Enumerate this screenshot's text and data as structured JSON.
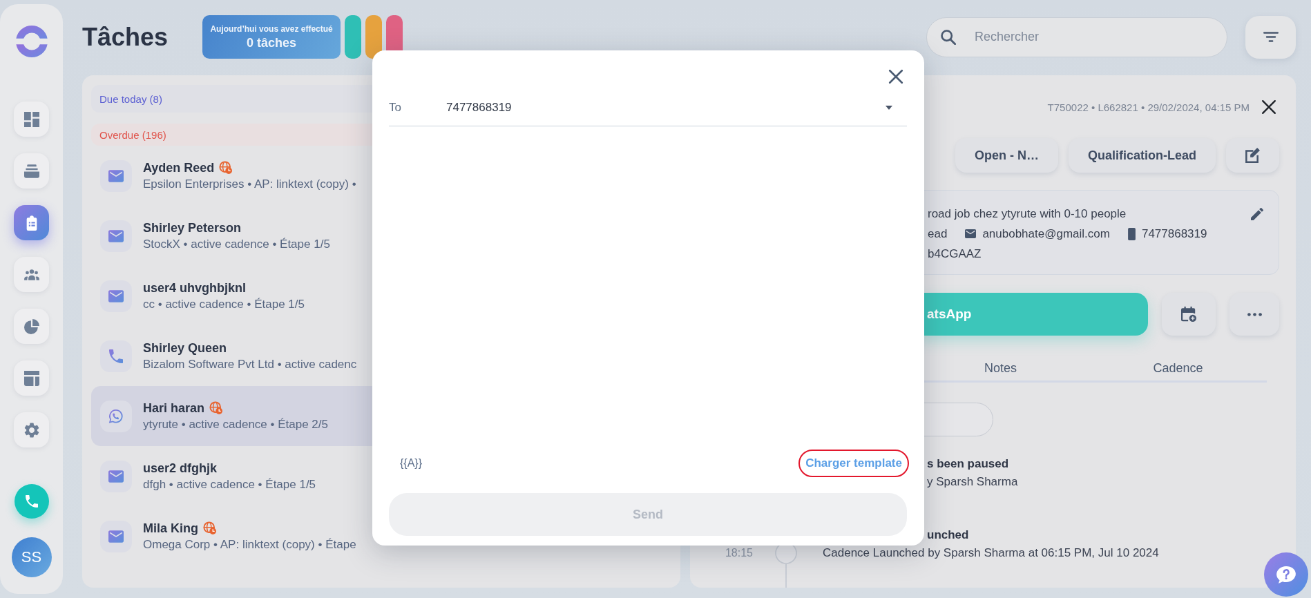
{
  "sidebar": {
    "nav_items": [
      {
        "kind": "dashboard",
        "selected": false
      },
      {
        "kind": "stack",
        "selected": false
      },
      {
        "kind": "tasks",
        "selected": true
      },
      {
        "kind": "team",
        "selected": false
      },
      {
        "kind": "reports",
        "selected": false
      },
      {
        "kind": "layout",
        "selected": false
      },
      {
        "kind": "settings",
        "selected": false
      }
    ],
    "avatar": {
      "initials": "SS"
    }
  },
  "header": {
    "title": "Tâches",
    "summary": {
      "caption": "Aujourd’hui vous avez effectué",
      "count": "0 tâches"
    },
    "stat_pills": [
      {
        "color": "#2fbfb5"
      },
      {
        "color": "#e6a23e"
      },
      {
        "color": "#df6283"
      }
    ],
    "search": {
      "placeholder": "Rechercher"
    }
  },
  "task_list": {
    "groups": [
      {
        "kind": "due",
        "label": "Due today (8)"
      },
      {
        "kind": "overdue",
        "label": "Overdue (196)",
        "items": [
          {
            "kind": "email",
            "name": "Ayden Reed",
            "timezone_badge": true,
            "details": "Epsilon Enterprises • AP: linktext (copy) •",
            "selected": false
          },
          {
            "kind": "email",
            "name": "Shirley Peterson",
            "timezone_badge": false,
            "details": "StockX • active cadence • Étape 1/5",
            "selected": false
          },
          {
            "kind": "email",
            "name": "user4 uhvghbjknl",
            "timezone_badge": false,
            "details": "cc • active cadence • Étape 1/5",
            "selected": false
          },
          {
            "kind": "phone",
            "name": "Shirley Queen",
            "timezone_badge": false,
            "details": "Bizalom Software Pvt Ltd • active cadenc",
            "selected": false
          },
          {
            "kind": "whatsapp",
            "name": "Hari haran",
            "timezone_badge": true,
            "details": "ytyrute • active cadence • Étape 2/5",
            "selected": true
          },
          {
            "kind": "email",
            "name": "user2 dfghjk",
            "timezone_badge": false,
            "details": "dfgh • active cadence • Étape 1/5",
            "selected": false
          },
          {
            "kind": "email",
            "name": "Mila King",
            "timezone_badge": true,
            "details": "Omega Corp • AP: linktext (copy) • Étape",
            "selected": false
          }
        ]
      }
    ]
  },
  "detail_panel": {
    "meta": "T750022 • L662821 • 29/02/2024, 04:15 PM",
    "status_buttons": [
      "Open - N…",
      "Qualification-Lead"
    ],
    "info_card": {
      "headline": "road job chez ytyrute with 0-10 people",
      "contact_fields": [
        {
          "kind": "role",
          "text": "ead"
        },
        {
          "kind": "email",
          "text": "anubobhate@gmail.com"
        },
        {
          "kind": "phone",
          "text": "7477868319"
        }
      ],
      "record_id": "b4CGAAZ"
    },
    "primary_action": "atsApp",
    "tabs": [
      {
        "label": "Notes",
        "selected": false
      },
      {
        "label": "Cadence",
        "selected": false
      }
    ],
    "timeline": [
      {
        "title": "s been paused",
        "description": "y Sparsh Sharma"
      },
      {
        "title": "unched",
        "time": "18:15",
        "description": "Cadence Launched by Sparsh Sharma at 06:15 PM, Jul 10 2024"
      }
    ]
  },
  "modal": {
    "recipient": {
      "label": "To",
      "value": "7477868319"
    },
    "variable_button": "{{A}}",
    "template_link": {
      "label": "Charger template",
      "highlighted": true
    },
    "send_button": {
      "label": "Send",
      "disabled": true
    }
  }
}
